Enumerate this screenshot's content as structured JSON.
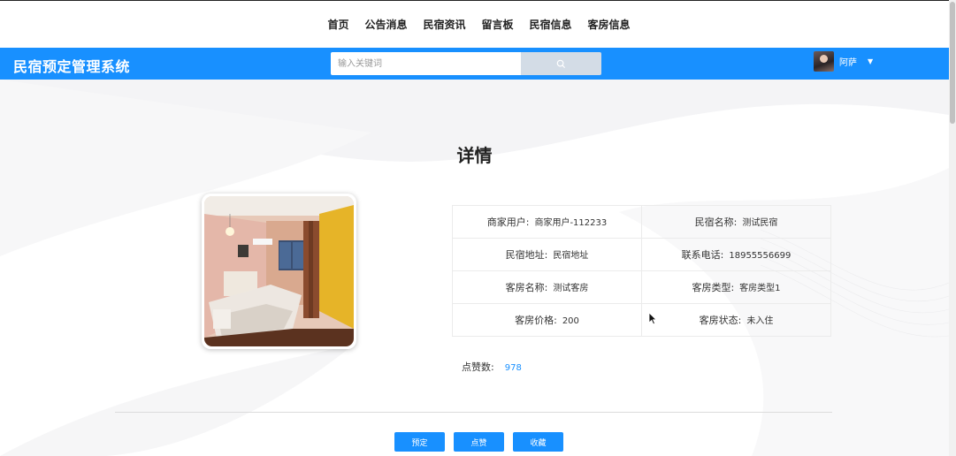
{
  "topnav": [
    "首页",
    "公告消息",
    "民宿资讯",
    "留言板",
    "民宿信息",
    "客房信息"
  ],
  "header": {
    "brand": "民宿预定管理系统",
    "search_placeholder": "输入关键词",
    "username": "阿萨"
  },
  "detail": {
    "title": "详情",
    "fields": [
      {
        "label": "商家用户:",
        "value": "商家用户-112233"
      },
      {
        "label": "民宿名称:",
        "value": "测试民宿"
      },
      {
        "label": "民宿地址:",
        "value": "民宿地址"
      },
      {
        "label": "联系电话:",
        "value": "18955556699"
      },
      {
        "label": "客房名称:",
        "value": "测试客房"
      },
      {
        "label": "客房类型:",
        "value": "客房类型1"
      },
      {
        "label": "客房价格:",
        "value": "200"
      },
      {
        "label": "客房状态:",
        "value": "未入住"
      }
    ],
    "likes_label": "点赞数:",
    "likes_value": "978"
  },
  "buttons": {
    "book": "预定",
    "like": "点赞",
    "favorite": "收藏"
  },
  "colors": {
    "primary": "#1890ff",
    "search_button": "#d3dce6"
  },
  "icons": {
    "search": "search-icon",
    "caret": "caret-down-icon"
  }
}
